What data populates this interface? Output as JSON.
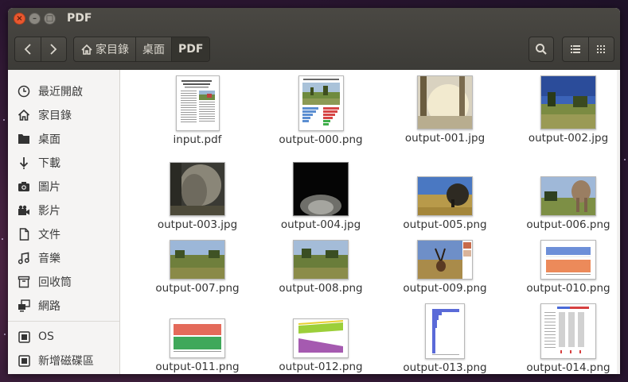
{
  "window": {
    "title": "PDF"
  },
  "breadcrumbs": [
    {
      "label": "家目錄"
    },
    {
      "label": "桌面"
    },
    {
      "label": "PDF"
    }
  ],
  "sidebar": {
    "items": [
      {
        "label": "最近開啟",
        "icon": "clock-icon"
      },
      {
        "label": "家目錄",
        "icon": "home-icon"
      },
      {
        "label": "桌面",
        "icon": "folder-icon"
      },
      {
        "label": "下載",
        "icon": "download-icon"
      },
      {
        "label": "圖片",
        "icon": "camera-icon"
      },
      {
        "label": "影片",
        "icon": "film-icon"
      },
      {
        "label": "文件",
        "icon": "document-icon"
      },
      {
        "label": "音樂",
        "icon": "music-icon"
      },
      {
        "label": "回收筒",
        "icon": "trash-icon"
      },
      {
        "label": "網路",
        "icon": "network-icon"
      }
    ],
    "devices": [
      {
        "label": "OS",
        "icon": "drive-icon"
      },
      {
        "label": "新增磁碟區",
        "icon": "drive-icon"
      }
    ]
  },
  "files": [
    {
      "name": "input.pdf",
      "kind": "pdf"
    },
    {
      "name": "output-000.png",
      "kind": "page"
    },
    {
      "name": "output-001.jpg",
      "kind": "photo"
    },
    {
      "name": "output-002.jpg",
      "kind": "photo"
    },
    {
      "name": "output-003.jpg",
      "kind": "photo"
    },
    {
      "name": "output-004.jpg",
      "kind": "photo"
    },
    {
      "name": "output-005.png",
      "kind": "photo"
    },
    {
      "name": "output-006.png",
      "kind": "photo"
    },
    {
      "name": "output-007.png",
      "kind": "photo"
    },
    {
      "name": "output-008.png",
      "kind": "photo"
    },
    {
      "name": "output-009.png",
      "kind": "photo"
    },
    {
      "name": "output-010.png",
      "kind": "chart"
    },
    {
      "name": "output-011.png",
      "kind": "chart"
    },
    {
      "name": "output-012.png",
      "kind": "chart"
    },
    {
      "name": "output-013.png",
      "kind": "chart"
    },
    {
      "name": "output-014.png",
      "kind": "chart"
    }
  ],
  "colors": {
    "titlebar": "#3c3b37",
    "close": "#e9582f",
    "sidebar": "#f5f4f3"
  }
}
